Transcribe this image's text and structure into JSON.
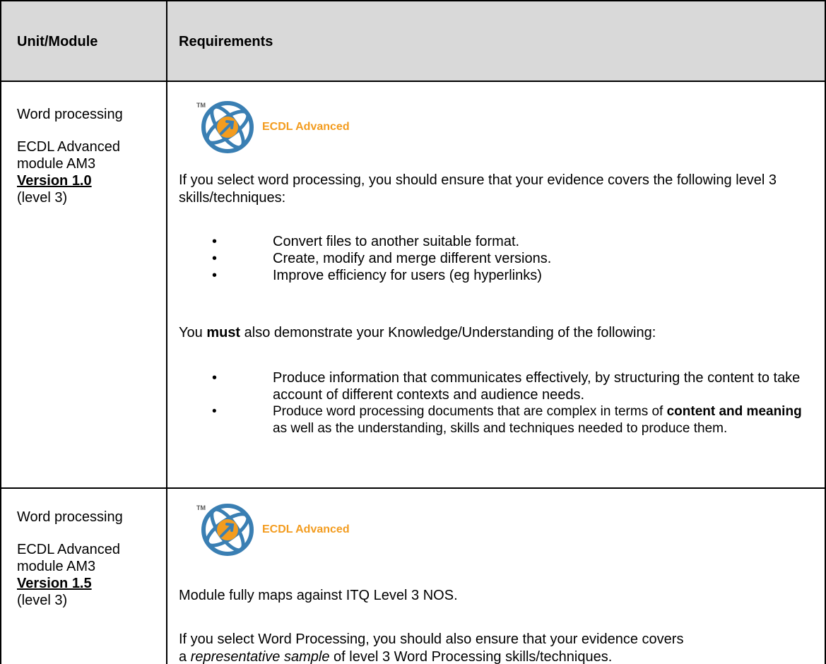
{
  "header": {
    "col1": "Unit/Module",
    "col2": "Requirements"
  },
  "rows": [
    {
      "left": {
        "line1": "Word processing",
        "line2": "ECDL Advanced",
        "line3": "module AM3",
        "version": "Version 1.0",
        "level": "(level 3)"
      },
      "logo": {
        "tm": "TM",
        "text": "ECDL Advanced"
      },
      "intro": "If you select word processing, you should ensure that your evidence covers the following level 3 skills/techniques:",
      "skills": [
        "Convert files to another suitable format.",
        "Create, modify and merge different versions.",
        "Improve efficiency for users (eg hyperlinks)"
      ],
      "must": {
        "pre": "You ",
        "bold": "must",
        "post": " also demonstrate your Knowledge/Understanding of the following:"
      },
      "knowledge1": "Produce information that communicates effectively, by structuring the content to take account of different contexts and audience needs.",
      "knowledge2": {
        "pre": "Produce word processing documents that are complex in terms of ",
        "bold": "content and meaning",
        "post": " as well as the understanding, skills and techniques needed to produce them."
      }
    },
    {
      "left": {
        "line1": "Word processing",
        "line2": "ECDL Advanced",
        "line3": "module AM3",
        "version": "Version 1.5",
        "level": "(level 3)"
      },
      "logo": {
        "tm": "TM",
        "text": "ECDL Advanced"
      },
      "maps": "Module fully maps against ITQ Level 3 NOS.",
      "ensure": {
        "line1": "If you select Word Processing, you should also ensure that your evidence covers",
        "pre": "a ",
        "italic": "representative sample",
        "post": " of level 3 Word Processing skills/techniques."
      }
    }
  ],
  "bullet": "•",
  "colors": {
    "header_bg": "#d9d9d9",
    "logo_blue": "#3a7fb3",
    "logo_orange": "#f39c1f"
  }
}
